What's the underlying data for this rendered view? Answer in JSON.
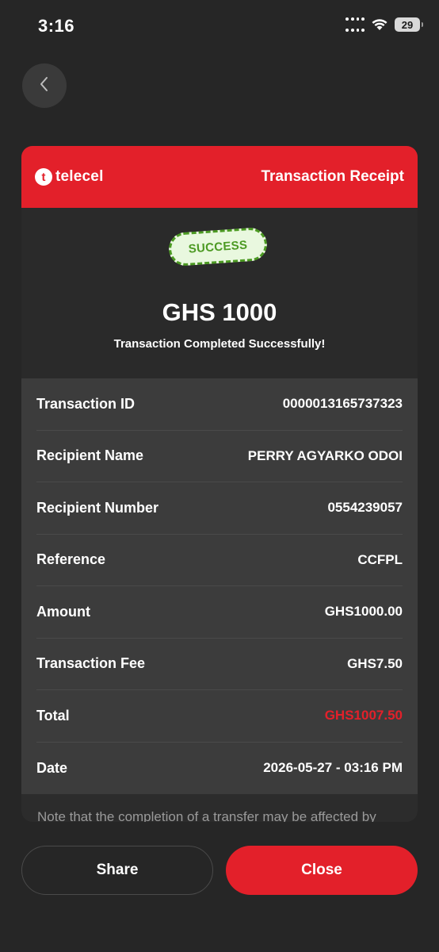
{
  "status_bar": {
    "time": "3:16",
    "battery": "29",
    "icons": [
      "signal-icon",
      "wifi-icon",
      "battery-icon"
    ]
  },
  "navigation": {
    "back_icon": "chevron-left-icon"
  },
  "receipt": {
    "brand": {
      "logo_mark": "t",
      "name": "telecel"
    },
    "title": "Transaction Receipt",
    "status_stamp": "SUCCESS",
    "amount": "GHS 1000",
    "status_message": "Transaction Completed Successfully!",
    "details": [
      {
        "label": "Transaction ID",
        "value": "0000013165737323"
      },
      {
        "label": "Recipient Name",
        "value": "PERRY AGYARKO ODOI"
      },
      {
        "label": "Recipient Number",
        "value": "0554239057"
      },
      {
        "label": "Reference",
        "value": "CCFPL"
      },
      {
        "label": "Amount",
        "value": "GHS1000.00"
      },
      {
        "label": "Transaction Fee",
        "value": "GHS7.50"
      },
      {
        "label": "Total",
        "value": "GHS1007.50"
      },
      {
        "label": "Date",
        "value": "2026-05-27 - 03:16 PM"
      }
    ],
    "note": "Note that the completion of a transfer may be affected by"
  },
  "actions": {
    "share_label": "Share",
    "close_label": "Close"
  },
  "colors": {
    "background": "#262626",
    "brand_red": "#e3202a",
    "success_green": "#4c9a23"
  }
}
